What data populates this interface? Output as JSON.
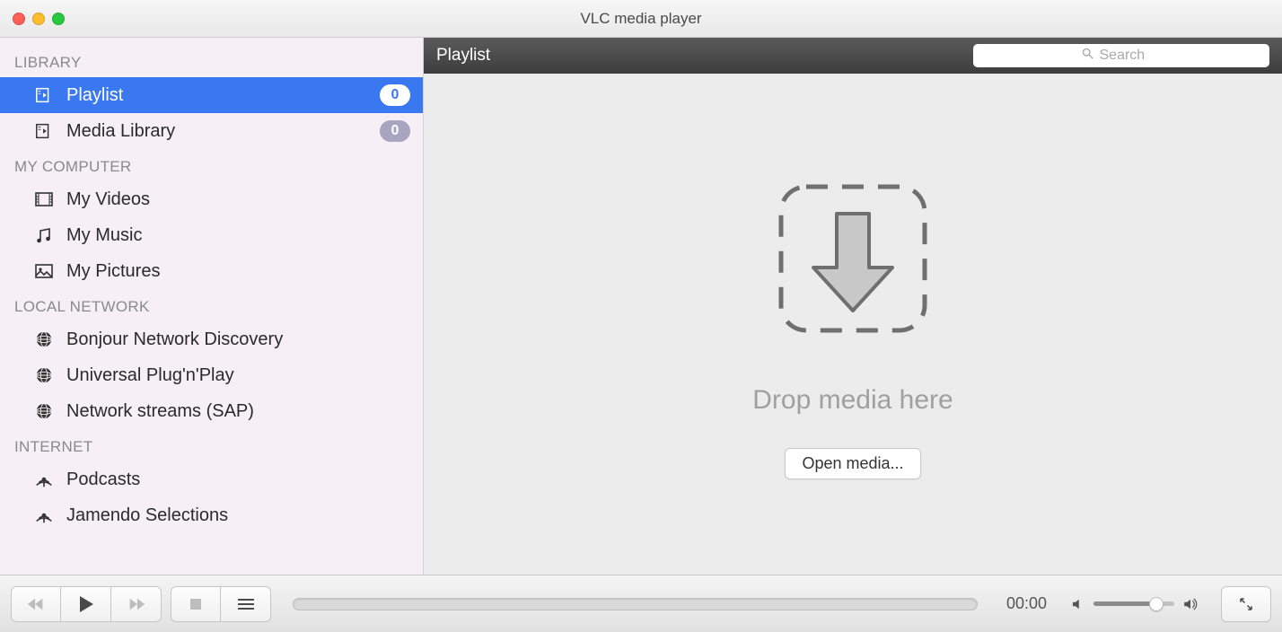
{
  "window": {
    "title": "VLC media player"
  },
  "sidebar": {
    "sections": [
      {
        "header": "LIBRARY",
        "items": [
          {
            "label": "Playlist",
            "count": "0",
            "selected": true,
            "icon": "playlist-icon"
          },
          {
            "label": "Media Library",
            "count": "0",
            "selected": false,
            "icon": "library-icon"
          }
        ]
      },
      {
        "header": "MY COMPUTER",
        "items": [
          {
            "label": "My Videos",
            "icon": "video-icon"
          },
          {
            "label": "My Music",
            "icon": "music-icon"
          },
          {
            "label": "My Pictures",
            "icon": "pictures-icon"
          }
        ]
      },
      {
        "header": "LOCAL NETWORK",
        "items": [
          {
            "label": "Bonjour Network Discovery",
            "icon": "network-icon"
          },
          {
            "label": "Universal Plug'n'Play",
            "icon": "network-icon"
          },
          {
            "label": "Network streams (SAP)",
            "icon": "network-icon"
          }
        ]
      },
      {
        "header": "INTERNET",
        "items": [
          {
            "label": "Podcasts",
            "icon": "podcast-icon"
          },
          {
            "label": "Jamendo Selections",
            "icon": "podcast-icon"
          }
        ]
      }
    ]
  },
  "content": {
    "header_title": "Playlist",
    "search_placeholder": "Search",
    "drop_text": "Drop media here",
    "open_media_label": "Open media..."
  },
  "controls": {
    "time": "00:00"
  }
}
